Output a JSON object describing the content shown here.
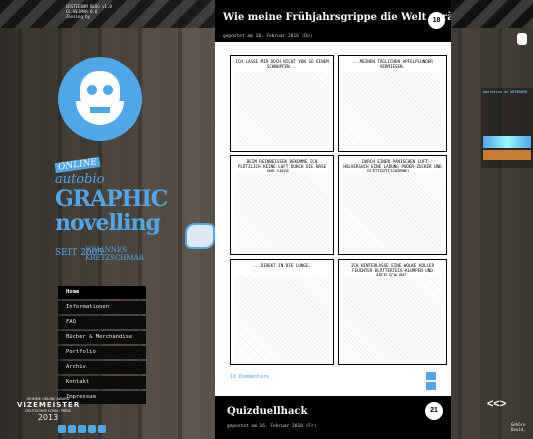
{
  "build_info": "ERSTIEBUM BLOG v1.0\nCL-WEIMAR 0.6\nZensing by",
  "logo": {
    "line1": "ONLINE",
    "line2": "autobio",
    "line3": "GRAPHIC",
    "line4": "novelling",
    "line5": "SEIT 2005",
    "line6": "JOHANNES KRETZSCHMAR"
  },
  "nav": {
    "items": [
      "Home",
      "Informationen",
      "FAQ",
      "Bücher & Merchandise",
      "Portfolio",
      "Archiv",
      "Kontakt",
      "Impressum"
    ]
  },
  "award": {
    "line1": "GRIMME ONLINE AWARD",
    "line2": "VIZEMEISTER",
    "line3": "DEUTSCHER COMIC PREIS",
    "year": "2013"
  },
  "post1": {
    "title": "Wie meine Frühjahrsgrippe die Welt verändert.",
    "comment_badge": "18",
    "meta": "gepostet am 18. Februar 2018 (Do)",
    "comic": {
      "panels": [
        "ICH LASSE MIR DOCH NICHT VON SO EINEM SCHNUPFEN...",
        "...MEINEN TÄGLICHEN APFELPLUNDER VERMIESEN.",
        "BEIM REINBEISSEN BEKOMME ICH PLÖTZLICH KEINE LUFT DURCH DIE NASE UND SAUGE...",
        "...DURCH EINEN PANISCHEN LUFT-HOLVERSUCH EINE LADUNG PUDER-ZUCKER UND BLÄTTERTEIGKRÜMEL...",
        "...DIREKT IN DIE LUNGE.",
        "ICH HINTERLASSE EINE WOLKE KOLLER FEUCHTER BLÄTTERTEIG-KLUMPEN UND APFELSCHLONZ."
      ]
    },
    "comments_link": "18 Kommentare"
  },
  "post2": {
    "title": "Quizduellhack",
    "comment_badge": "21",
    "meta": "gepostet am 16. Februar 2018 (Fr)"
  },
  "right": {
    "widget_title": "Operation at WEIMARER",
    "corner_text": "Gehöre\nDavid,"
  },
  "icons": {
    "rabbit": "rabbit-icon",
    "hand": "pointing-hand-icon",
    "share_facebook": "facebook-icon",
    "share_twitter": "twitter-icon"
  },
  "colors": {
    "accent": "#4fa6e8",
    "content_bg": "#ffffff",
    "header_bg": "#000000"
  }
}
